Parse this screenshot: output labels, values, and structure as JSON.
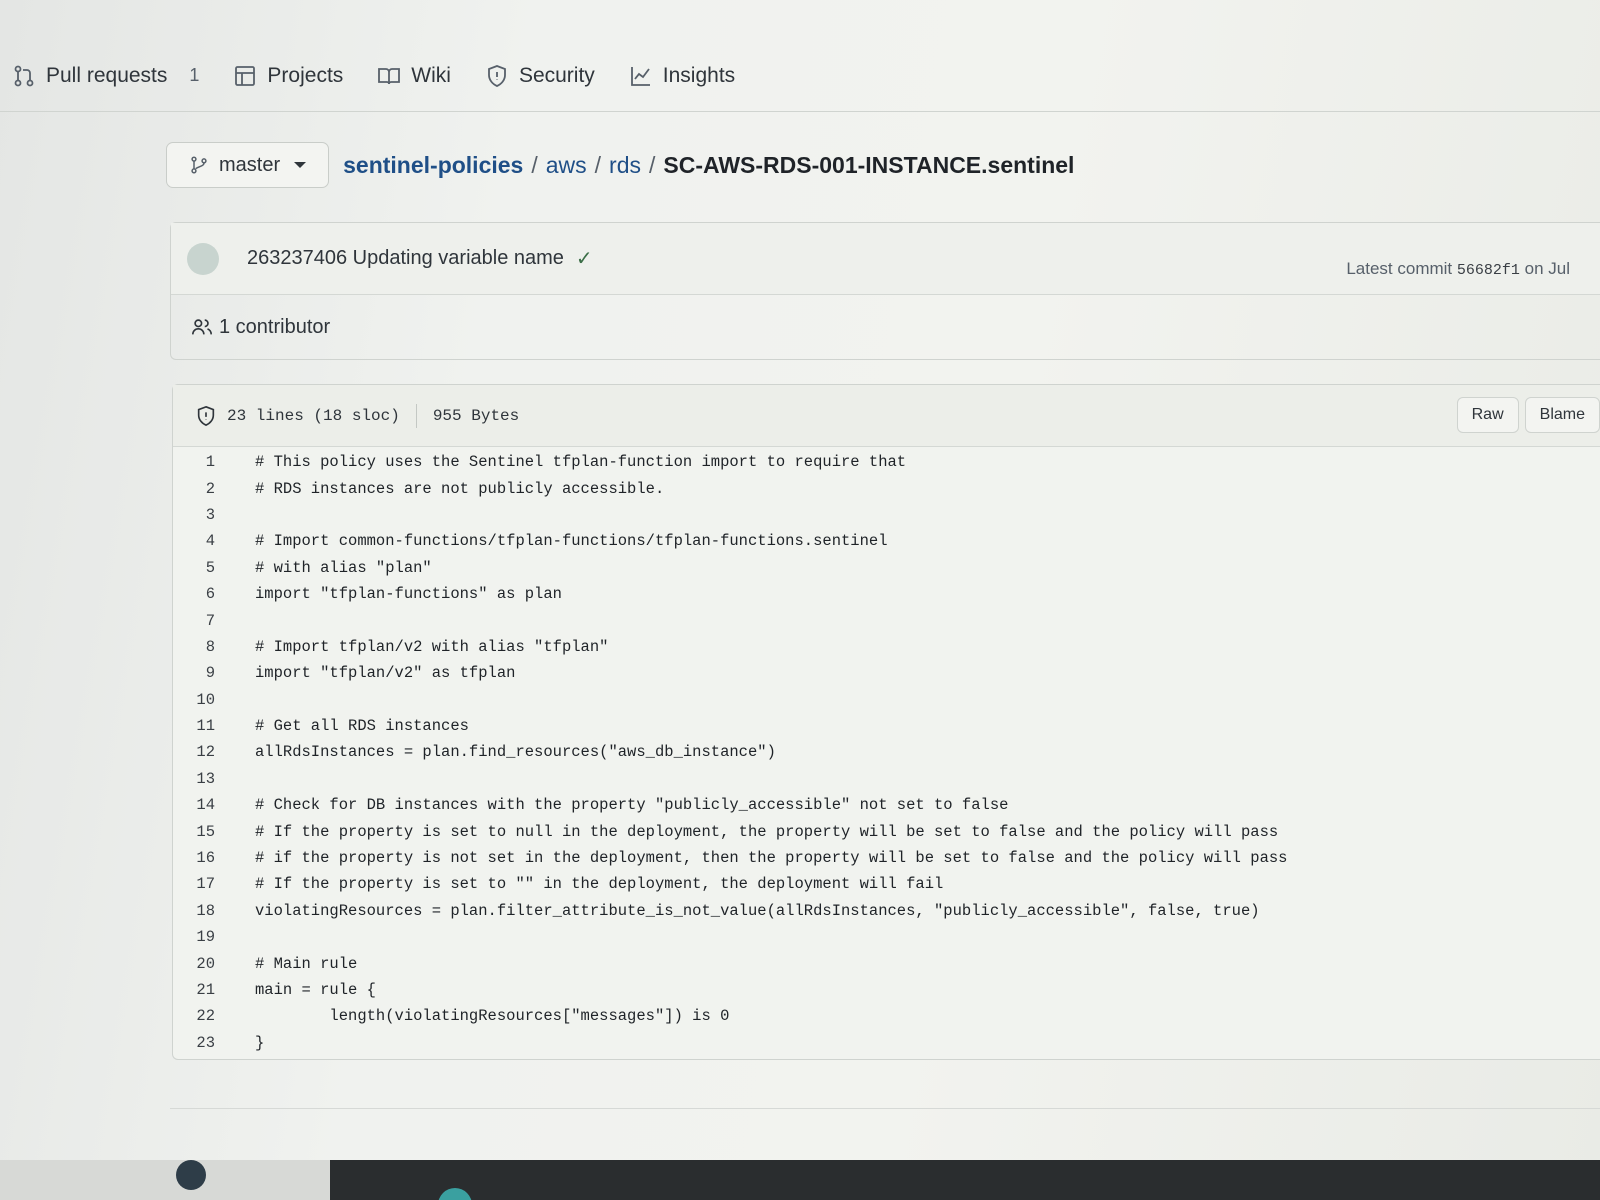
{
  "repo_nav": {
    "pull_requests": "Pull requests",
    "pull_requests_count": "1",
    "projects": "Projects",
    "wiki": "Wiki",
    "security": "Security",
    "insights": "Insights"
  },
  "branch": {
    "name": "master"
  },
  "breadcrumb": {
    "repo": "sentinel-policies",
    "sep": "/",
    "dir1": "aws",
    "dir2": "rds",
    "file": "SC-AWS-RDS-001-INSTANCE.sentinel"
  },
  "commit": {
    "message": "263237406 Updating variable name",
    "check": "✓",
    "latest_prefix": "Latest commit",
    "sha": "56682f1",
    "date_suffix": "on Jul",
    "contributors": "1 contributor"
  },
  "file": {
    "lines_info": "23 lines (18 sloc)",
    "size": "955 Bytes",
    "raw_label": "Raw",
    "blame_label": "Blame"
  },
  "code": [
    {
      "n": "1",
      "t": "# This policy uses the Sentinel tfplan-function import to require that"
    },
    {
      "n": "2",
      "t": "# RDS instances are not publicly accessible."
    },
    {
      "n": "3",
      "t": ""
    },
    {
      "n": "4",
      "t": "# Import common-functions/tfplan-functions/tfplan-functions.sentinel"
    },
    {
      "n": "5",
      "t": "# with alias \"plan\""
    },
    {
      "n": "6",
      "t": "import \"tfplan-functions\" as plan"
    },
    {
      "n": "7",
      "t": ""
    },
    {
      "n": "8",
      "t": "# Import tfplan/v2 with alias \"tfplan\""
    },
    {
      "n": "9",
      "t": "import \"tfplan/v2\" as tfplan"
    },
    {
      "n": "10",
      "t": ""
    },
    {
      "n": "11",
      "t": "# Get all RDS instances"
    },
    {
      "n": "12",
      "t": "allRdsInstances = plan.find_resources(\"aws_db_instance\")"
    },
    {
      "n": "13",
      "t": ""
    },
    {
      "n": "14",
      "t": "# Check for DB instances with the property \"publicly_accessible\" not set to false"
    },
    {
      "n": "15",
      "t": "# If the property is set to null in the deployment, the property will be set to false and the policy will pass"
    },
    {
      "n": "16",
      "t": "# if the property is not set in the deployment, then the property will be set to false and the policy will pass"
    },
    {
      "n": "17",
      "t": "# If the property is set to \"\" in the deployment, the deployment will fail"
    },
    {
      "n": "18",
      "t": "violatingResources = plan.filter_attribute_is_not_value(allRdsInstances, \"publicly_accessible\", false, true)"
    },
    {
      "n": "19",
      "t": ""
    },
    {
      "n": "20",
      "t": "# Main rule"
    },
    {
      "n": "21",
      "t": "main = rule {"
    },
    {
      "n": "22",
      "t": "        length(violatingResources[\"messages\"]) is 0"
    },
    {
      "n": "23",
      "t": "}"
    }
  ]
}
